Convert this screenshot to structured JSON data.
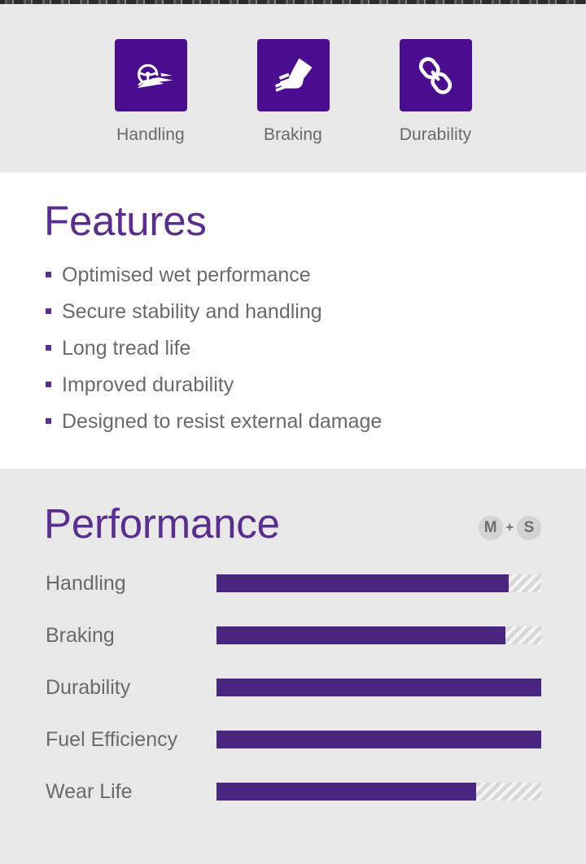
{
  "icon_band": {
    "items": [
      {
        "icon": "steering-wheel-icon",
        "label": "Handling"
      },
      {
        "icon": "brake-pedal-foot-icon",
        "label": "Braking"
      },
      {
        "icon": "chain-link-icon",
        "label": "Durability"
      }
    ]
  },
  "features": {
    "title": "Features",
    "items": [
      "Optimised wet performance",
      "Secure stability and handling",
      "Long tread life",
      "Improved durability",
      "Designed to resist external damage"
    ]
  },
  "performance": {
    "title": "Performance",
    "badge": {
      "left": "M",
      "plus": "+",
      "right": "S"
    },
    "rows": [
      {
        "label": "Handling",
        "value": 90
      },
      {
        "label": "Braking",
        "value": 89
      },
      {
        "label": "Durability",
        "value": 100
      },
      {
        "label": "Fuel Efficiency",
        "value": 100
      },
      {
        "label": "Wear Life",
        "value": 80
      }
    ]
  },
  "colors": {
    "brand_purple": "#4b0d8f",
    "heading_purple": "#5a2d91",
    "bar_purple": "#4b2582",
    "band_grey": "#e8e8e8",
    "text_grey": "#6a6a6a",
    "track_grey": "#d8d8d8"
  },
  "chart_data": {
    "type": "bar",
    "title": "Performance",
    "categories": [
      "Handling",
      "Braking",
      "Durability",
      "Fuel Efficiency",
      "Wear Life"
    ],
    "values": [
      90,
      89,
      100,
      100,
      80
    ],
    "xlabel": "",
    "ylabel": "",
    "ylim": [
      0,
      100
    ],
    "orientation": "horizontal",
    "grid": false,
    "legend": "none"
  }
}
